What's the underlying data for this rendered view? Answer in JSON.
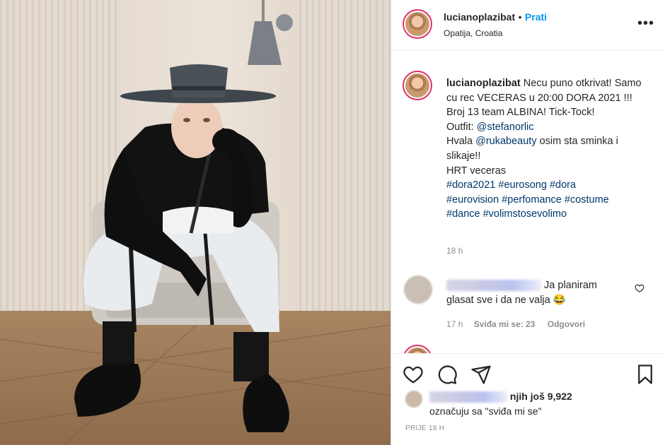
{
  "post": {
    "username": "lucianoplazibat",
    "separator": "•",
    "follow_label": "Prati",
    "location": "Opatija, Croatia",
    "more_label": "•••"
  },
  "caption": {
    "username": "lucianoplazibat",
    "text1": "Necu puno otkrivat! Samo cu rec VECERAS u 20:00 DORA 2021 !!! Broj 13 team ALBINA! Tick-Tock!",
    "outfit_prefix": "Outfit: ",
    "outfit_mention": "@stefanorlic",
    "thanks_prefix": "Hvala ",
    "thanks_mention": "@rukabeauty",
    "thanks_suffix": " osim sta sminka i slikaje!!",
    "line_hrt": "HRT veceras",
    "hashtags": [
      "#dora2021",
      "#eurosong",
      "#dora",
      "#eurovision",
      "#perfomance",
      "#costume",
      "#dance",
      "#volimstosevolimo"
    ],
    "age": "18 h"
  },
  "comment": {
    "text": "Ja planiram glasat sve i da ne valja 😂",
    "age": "17 h",
    "likes": "Sviđa mi se: 23",
    "reply": "Odgovori"
  },
  "footer": {
    "likes_suffix": "njih još 9,922",
    "likes_line2": "označuju sa \"sviđa mi se\"",
    "timestamp": "PRIJE 18 H"
  },
  "icons": {
    "like": "heart-icon",
    "comment": "comment-icon",
    "share": "paper-plane-icon",
    "save": "bookmark-icon"
  }
}
